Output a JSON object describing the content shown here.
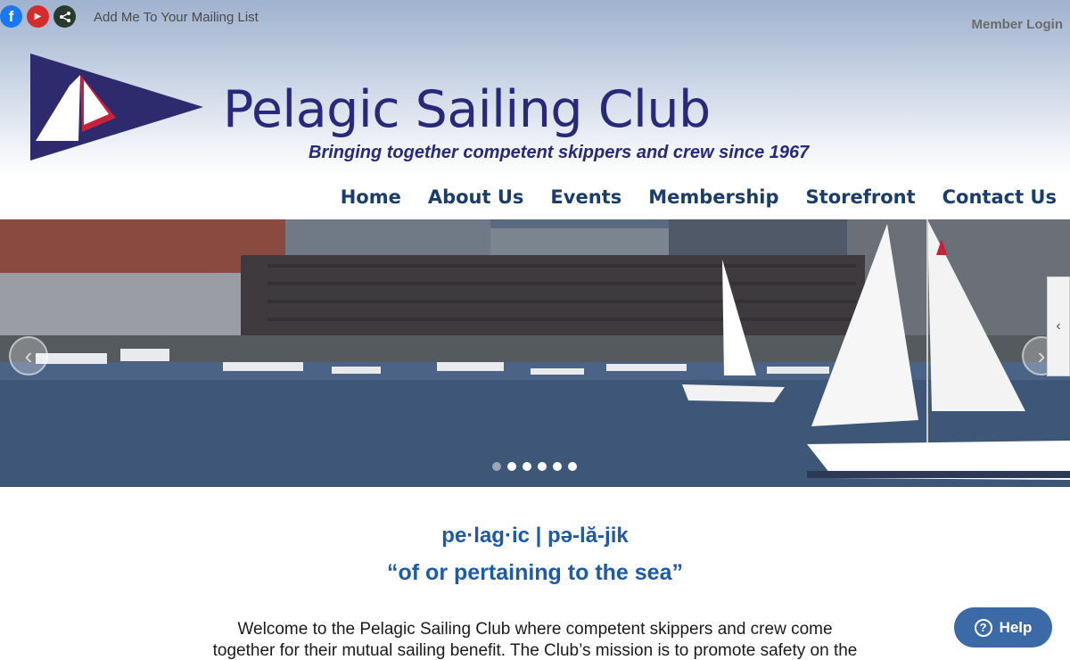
{
  "topbar": {
    "social": [
      {
        "name": "facebook-icon",
        "glyph": "f"
      },
      {
        "name": "youtube-icon",
        "glyph": "▶"
      },
      {
        "name": "share-icon",
        "glyph": "⋖"
      }
    ],
    "mailing_link": "Add Me To Your Mailing List",
    "member_login": "Member Login"
  },
  "brand": {
    "title": "Pelagic Sailing Club",
    "tagline": "Bringing together competent skippers and crew since 1967",
    "colors": {
      "primary": "#28297a",
      "accent": "#c8213a",
      "link": "#1e5aa8"
    }
  },
  "nav": {
    "items": [
      {
        "label": "Home"
      },
      {
        "label": "About Us"
      },
      {
        "label": "Events"
      },
      {
        "label": "Membership"
      },
      {
        "label": "Storefront"
      },
      {
        "label": "Contact Us"
      }
    ]
  },
  "hero": {
    "prev_glyph": "‹",
    "next_glyph": "›",
    "side_tab_glyph": "‹",
    "slide_count": 6,
    "active_slide": 1
  },
  "content": {
    "pronunciation": "pe·lag·ic | pə-lă-jik",
    "definition": "“of or pertaining to the sea”",
    "welcome_line1": "Welcome to the Pelagic Sailing Club where competent skippers and crew come",
    "welcome_line2": "together for their mutual sailing benefit. The Club’s mission is to promote safety on the"
  },
  "help": {
    "label": "Help",
    "icon": "?"
  }
}
